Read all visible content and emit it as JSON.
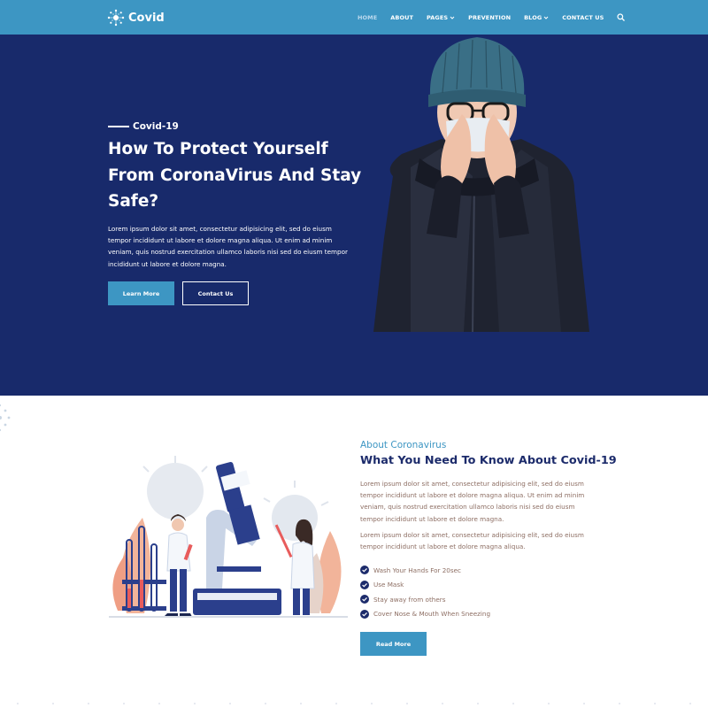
{
  "brand": {
    "name": "Covid"
  },
  "nav": {
    "items": [
      {
        "label": "HOME",
        "active": true,
        "dropdown": false
      },
      {
        "label": "ABOUT",
        "active": false,
        "dropdown": false
      },
      {
        "label": "PAGES",
        "active": false,
        "dropdown": true
      },
      {
        "label": "PREVENTION",
        "active": false,
        "dropdown": false
      },
      {
        "label": "BLOG",
        "active": false,
        "dropdown": true
      },
      {
        "label": "CONTACT US",
        "active": false,
        "dropdown": false
      }
    ],
    "search_icon": "search-icon"
  },
  "hero": {
    "kicker": "Covid-19",
    "title": "How To Protect Yourself From CoronaVirus And Stay Safe?",
    "text": "Lorem ipsum dolor sit amet, consectetur adipisicing elit, sed do eiusm tempor incididunt ut labore et dolore magna aliqua. Ut enim ad minim veniam, quis nostrud exercitation ullamco laboris nisi sed do eiusm tempor incididunt ut labore et dolore magna.",
    "primary_button": "Learn More",
    "secondary_button": "Contact Us"
  },
  "about": {
    "kicker": "About Coronavirus",
    "title": "What You Need To Know About Covid-19",
    "paragraph1": "Lorem ipsum dolor sit amet, consectetur adipisicing elit, sed do eiusm tempor incididunt ut labore et dolore magna aliqua. Ut enim ad minim veniam, quis nostrud exercitation ullamco laboris nisi sed do eiusm tempor incididunt ut labore et dolore magna.",
    "paragraph2": "Lorem ipsum dolor sit amet, consectetur adipisicing elit, sed do eiusm tempor incididunt ut labore et dolore magna aliqua.",
    "checklist": [
      "Wash Your Hands For 20sec",
      "Use Mask",
      "Stay away from others",
      "Cover Nose & Mouth When Sneezing"
    ],
    "button": "Read More"
  },
  "colors": {
    "navbar": "#3d96c3",
    "hero_bg": "#182a6b",
    "accent": "#3d96c3",
    "heading": "#1c2b6b",
    "body_text": "#8d6e63"
  }
}
